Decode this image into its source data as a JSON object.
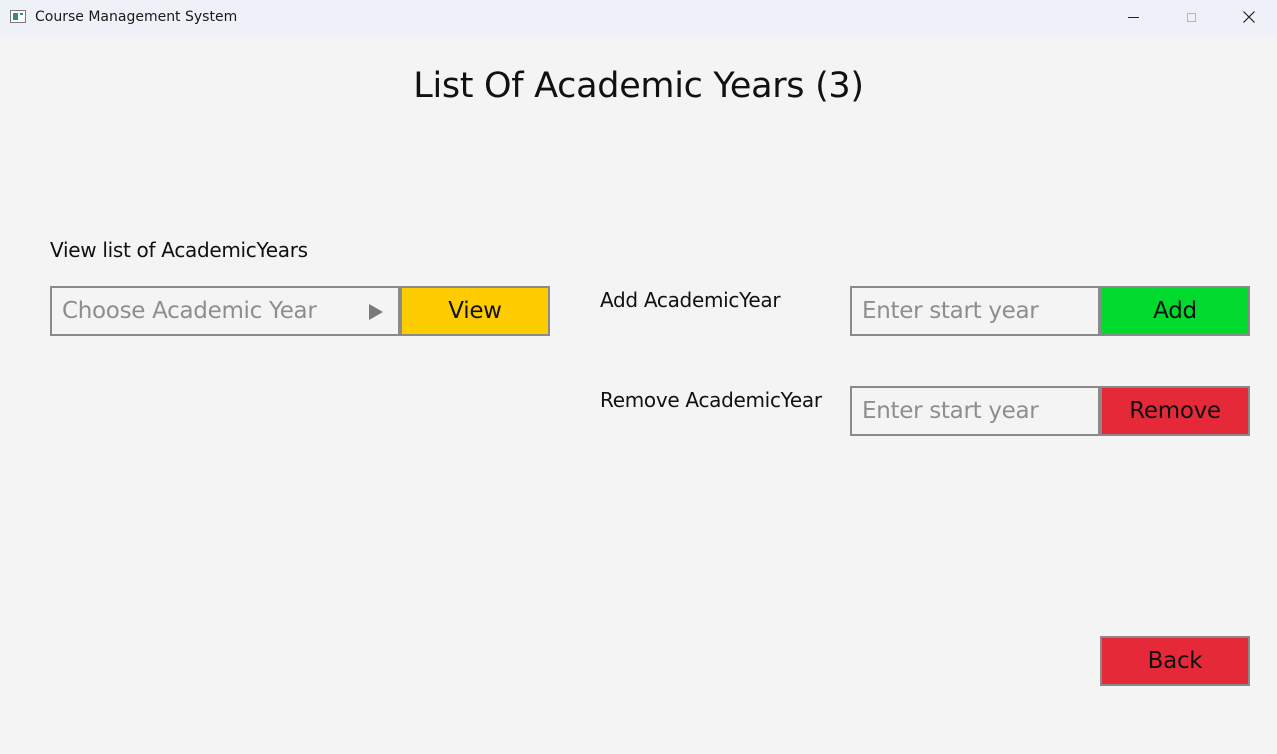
{
  "window": {
    "title": "Course Management System",
    "controls": {
      "minimize_icon": "minimize-icon",
      "maximize_icon": "maximize-icon",
      "close_icon": "close-icon"
    }
  },
  "main": {
    "heading": "List Of Academic Years (3)",
    "view_section": {
      "label": "View list of AcademicYears",
      "dropdown_placeholder": "Choose Academic Year",
      "dropdown_icon": "triangle-right-icon",
      "view_button": "View"
    },
    "add_section": {
      "label": "Add AcademicYear",
      "input_placeholder": "Enter start year",
      "input_value": "",
      "add_button": "Add"
    },
    "remove_section": {
      "label": "Remove AcademicYear",
      "input_placeholder": "Enter start year",
      "input_value": "",
      "remove_button": "Remove"
    },
    "back_button": "Back"
  },
  "colors": {
    "background": "#f4f4f4",
    "titlebar": "#eef1f7",
    "view_button": "#ffcc00",
    "add_button": "#00d92d",
    "remove_button": "#e62938",
    "back_button": "#e62938",
    "border": "#8a8a8a",
    "placeholder_text": "#8e8e8e"
  }
}
